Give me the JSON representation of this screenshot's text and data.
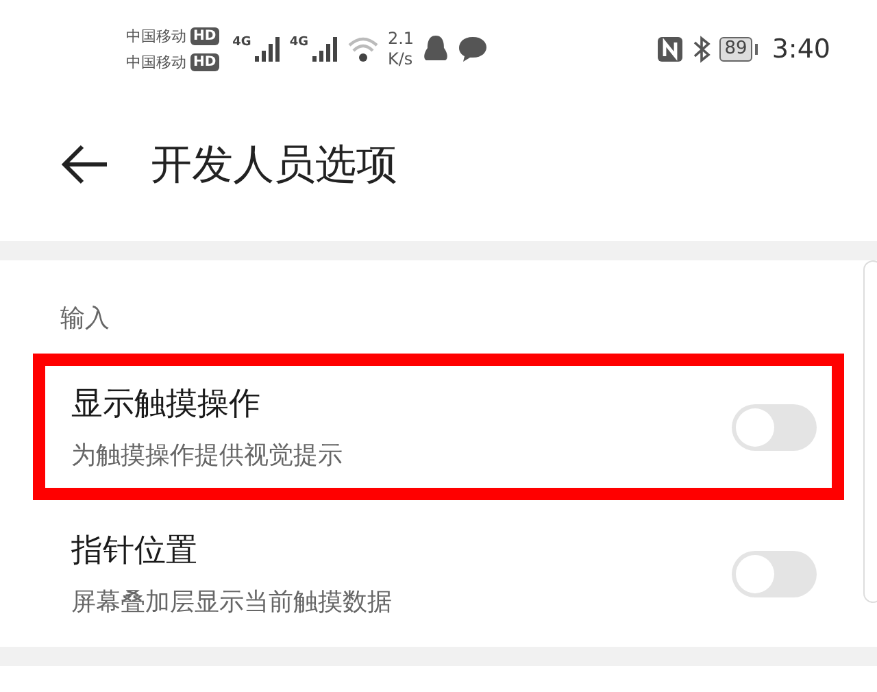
{
  "status_bar": {
    "carriers": [
      {
        "name": "中国移动",
        "badge": "HD"
      },
      {
        "name": "中国移动",
        "badge": "HD"
      }
    ],
    "networks": [
      "4G",
      "4G"
    ],
    "speed": [
      "2.1",
      "K/s"
    ],
    "battery": "89",
    "time": "3:40"
  },
  "header": {
    "title": "开发人员选项"
  },
  "section": {
    "label": "输入",
    "items": [
      {
        "title": "显示触摸操作",
        "subtitle": "为触摸操作提供视觉提示",
        "on": false,
        "highlighted": true
      },
      {
        "title": "指针位置",
        "subtitle": "屏幕叠加层显示当前触摸数据",
        "on": false,
        "highlighted": false
      }
    ]
  }
}
